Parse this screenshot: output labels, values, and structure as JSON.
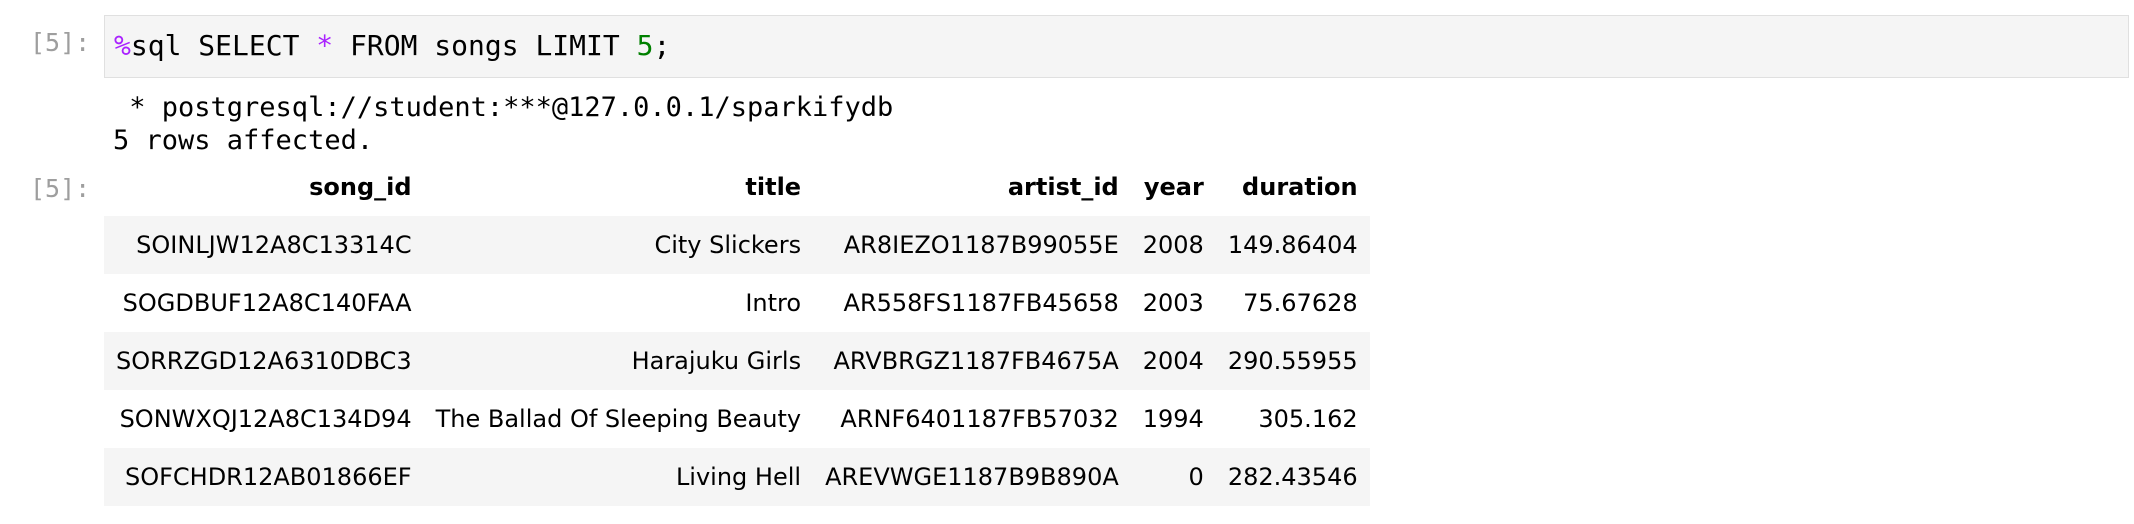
{
  "input_cell": {
    "prompt": "[5]:",
    "code": {
      "magic": "%",
      "part1": "sql SELECT ",
      "star": "*",
      "part2": " FROM songs LIMIT ",
      "number": "5",
      "part3": ";"
    }
  },
  "output": {
    "stream_line_1": " * postgresql://student:***@127.0.0.1/sparkifydb",
    "stream_line_2": "5 rows affected.",
    "prompt": "[5]:",
    "table": {
      "columns": [
        "song_id",
        "title",
        "artist_id",
        "year",
        "duration"
      ],
      "rows": [
        [
          "SOINLJW12A8C13314C",
          "City Slickers",
          "AR8IEZO1187B99055E",
          "2008",
          "149.86404"
        ],
        [
          "SOGDBUF12A8C140FAA",
          "Intro",
          "AR558FS1187FB45658",
          "2003",
          "75.67628"
        ],
        [
          "SORRZGD12A6310DBC3",
          "Harajuku Girls",
          "ARVBRGZ1187FB4675A",
          "2004",
          "290.55955"
        ],
        [
          "SONWXQJ12A8C134D94",
          "The Ballad Of Sleeping Beauty",
          "ARNF6401187FB57032",
          "1994",
          "305.162"
        ],
        [
          "SOFCHDR12AB01866EF",
          "Living Hell",
          "AREVWGE1187B9B890A",
          "0",
          "282.43546"
        ]
      ]
    }
  },
  "colors": {
    "prompt": "#9e9e9e",
    "input_bg": "#f5f5f5",
    "magic": "#aa22ff",
    "number": "#008000"
  }
}
